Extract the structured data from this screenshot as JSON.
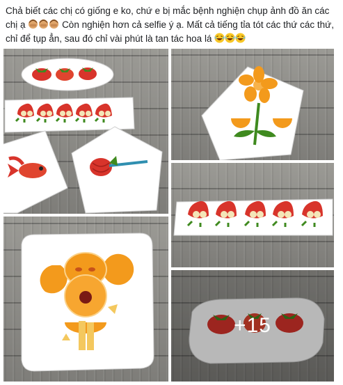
{
  "post": {
    "text_part1": "Chả biết các chị có giống e ko, chứ e bị mắc bệnh nghiện chụp ảnh đồ ăn các chị ạ",
    "text_part2": "Còn nghiện hơn cả selfie ý ạ. Mất cả tiếng tỉa tót các thứ các thứ, chỉ để tụp ẳn, sau đó chỉ vài phút là tan tác hoa lá",
    "emoji_after_part1": [
      "person-facepalming-emoji",
      "person-facepalming-emoji",
      "person-facepalming-emoji"
    ],
    "emoji_after_part2": [
      "laughing-emoji",
      "laughing-emoji",
      "laughing-emoji"
    ]
  },
  "photos": {
    "more_count_label": "+15"
  },
  "colors": {
    "strawberry": "#d8342b",
    "orange": "#f39a1c",
    "leaf": "#3f8a1f",
    "plate": "#ffffff"
  }
}
